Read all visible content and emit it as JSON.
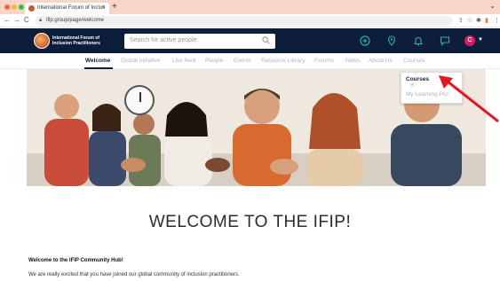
{
  "browser": {
    "tab_title": "International Forum of Inclus",
    "tab_close": "×",
    "new_tab": "+",
    "tabs_menu": "⌄",
    "url": "ifip.group/page/welcome",
    "back": "←",
    "forward": "→",
    "reload": "C"
  },
  "header": {
    "logo_text": "International Forum of Inclusion Practitioners",
    "search_placeholder": "Search for active people",
    "avatar_letter": "C",
    "colors": {
      "navy": "#0d1e3a",
      "accent": "#d81b60",
      "icon": "#2bb0a8"
    }
  },
  "nav": {
    "items": [
      "Welcome",
      "Global Initiative",
      "Live feed",
      "People",
      "Events",
      "Resource Library",
      "Forums",
      "News",
      "About Us",
      "Courses"
    ]
  },
  "dropdown": {
    "items": [
      "Courses",
      "My Learning Pro"
    ]
  },
  "main": {
    "title": "WELCOME TO THE IFIP!",
    "hub_title": "Welcome to the IFIP Community Hub!",
    "hub_text": "We are really excited that you have joined our global community of inclusion practitioners."
  }
}
